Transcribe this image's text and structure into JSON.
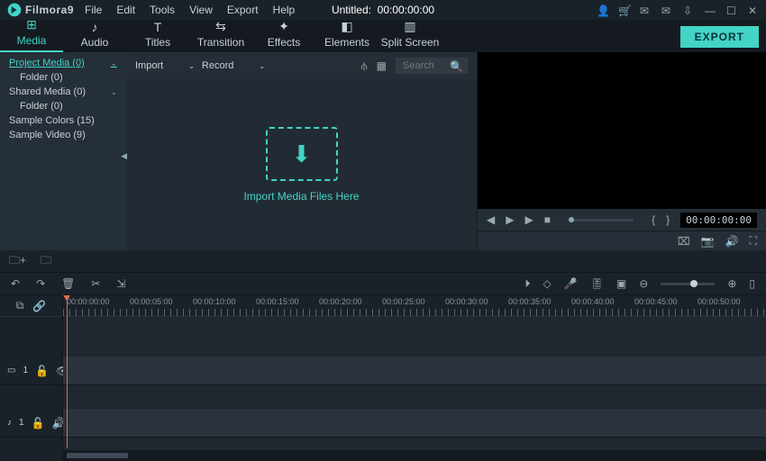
{
  "app": {
    "name": "Filmora9",
    "title_prefix": "Untitled:",
    "title_time": "00:00:00:00"
  },
  "menu": [
    "File",
    "Edit",
    "Tools",
    "View",
    "Export",
    "Help"
  ],
  "tooltabs": [
    {
      "label": "Media",
      "glyph": "⊞"
    },
    {
      "label": "Audio",
      "glyph": "♪"
    },
    {
      "label": "Titles",
      "glyph": "T"
    },
    {
      "label": "Transition",
      "glyph": "⇆"
    },
    {
      "label": "Effects",
      "glyph": "✦"
    },
    {
      "label": "Elements",
      "glyph": "◧"
    },
    {
      "label": "Split Screen",
      "glyph": "▥"
    }
  ],
  "export_label": "EXPORT",
  "sidebar": {
    "items": [
      {
        "label": "Project Media (0)",
        "selected": true,
        "chev": true
      },
      {
        "label": "Folder (0)",
        "sub": true
      },
      {
        "label": "Shared Media (0)",
        "chev": true
      },
      {
        "label": "Folder (0)",
        "sub": true
      },
      {
        "label": "Sample Colors (15)"
      },
      {
        "label": "Sample Video (9)"
      }
    ]
  },
  "mediabar": {
    "import": "Import",
    "record": "Record",
    "search_ph": "Search"
  },
  "importzone": {
    "label": "Import Media Files Here"
  },
  "preview": {
    "timecode": "00:00:00:00",
    "markers": {
      "in": "{",
      "out": "}"
    }
  },
  "ruler": [
    "00:00:00:00",
    "00:00:05:00",
    "00:00:10:00",
    "00:00:15:00",
    "00:00:20:00",
    "00:00:25:00",
    "00:00:30:00",
    "00:00:35:00",
    "00:00:40:00",
    "00:00:45:00",
    "00:00:50:00"
  ],
  "tracks": {
    "video": "1",
    "audio": "1"
  }
}
